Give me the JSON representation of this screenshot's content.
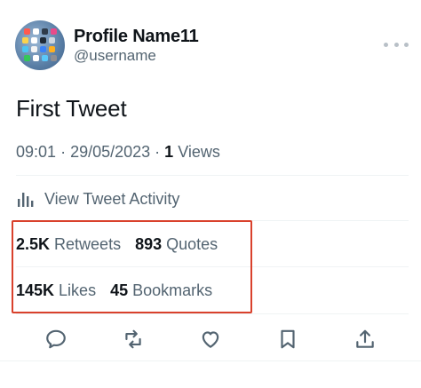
{
  "profile": {
    "name": "Profile Name11",
    "username": "@username"
  },
  "tweet": {
    "text": "First Tweet",
    "time": "09:01",
    "date": "29/05/2023",
    "views_count": "1",
    "views_label": "Views"
  },
  "activity": {
    "label": "View Tweet Activity",
    "icon": "bar-chart-icon"
  },
  "stats": {
    "retweets_count": "2.5K",
    "retweets_label": "Retweets",
    "quotes_count": "893",
    "quotes_label": "Quotes",
    "likes_count": "145K",
    "likes_label": "Likes",
    "bookmarks_count": "45",
    "bookmarks_label": "Bookmarks"
  },
  "actions": [
    "reply-icon",
    "retweet-icon",
    "like-icon",
    "bookmark-icon",
    "share-icon"
  ],
  "colors": {
    "highlight": "#d9412c",
    "secondary_text": "#536471",
    "primary_text": "#0f1419"
  }
}
